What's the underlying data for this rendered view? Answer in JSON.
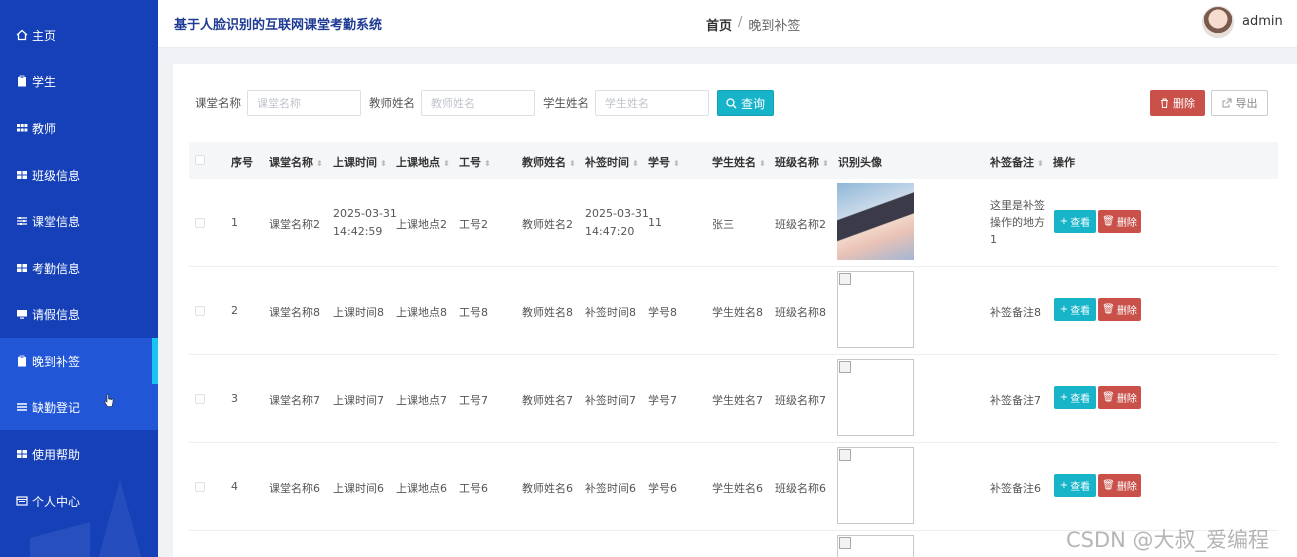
{
  "sidebar": {
    "items": [
      {
        "label": "主页",
        "icon": "home-icon"
      },
      {
        "label": "学生",
        "icon": "clipboard-icon"
      },
      {
        "label": "教师",
        "icon": "grid-icon"
      },
      {
        "label": "班级信息",
        "icon": "grid-icon"
      },
      {
        "label": "课堂信息",
        "icon": "sliders-icon"
      },
      {
        "label": "考勤信息",
        "icon": "grid-icon"
      },
      {
        "label": "请假信息",
        "icon": "monitor-icon"
      },
      {
        "label": "晚到补签",
        "icon": "clipboard-icon",
        "active": true
      },
      {
        "label": "缺勤登记",
        "icon": "list-icon"
      },
      {
        "label": "使用帮助",
        "icon": "grid-icon"
      },
      {
        "label": "个人中心",
        "icon": "id-card-icon"
      }
    ]
  },
  "header": {
    "title": "基于人脸识别的互联网课堂考勤系统",
    "breadcrumb_home": "首页",
    "breadcrumb_sep": "/",
    "breadcrumb_current": "晚到补签",
    "username": "admin"
  },
  "search": {
    "course_label": "课堂名称",
    "course_placeholder": "课堂名称",
    "teacher_label": "教师姓名",
    "teacher_placeholder": "教师姓名",
    "student_label": "学生姓名",
    "student_placeholder": "学生姓名",
    "query_label": "查询",
    "delete_label": "删除",
    "export_label": "导出"
  },
  "table": {
    "headers": {
      "index": "序号",
      "course": "课堂名称",
      "class_time": "上课时间",
      "place": "上课地点",
      "job_no": "工号",
      "teacher": "教师姓名",
      "sign_time": "补签时间",
      "student_no": "学号",
      "student": "学生姓名",
      "class_name": "班级名称",
      "photo": "识别头像",
      "remark": "补签备注",
      "action": "操作"
    },
    "view_label": "查看",
    "delete_label": "删除",
    "rows": [
      {
        "index": "1",
        "course": "课堂名称2",
        "class_time_date": "2025-03-31",
        "class_time_clock": "14:42:59",
        "place": "上课地点2",
        "job_no": "工号2",
        "teacher": "教师姓名2",
        "sign_time_date": "2025-03-31",
        "sign_time_clock": "14:47:20",
        "student_no": "11",
        "student": "张三",
        "class_name": "班级名称2",
        "remark_l1": "这里是补签",
        "remark_l2": "操作的地方",
        "remark_l3": "1"
      },
      {
        "index": "2",
        "course": "课堂名称8",
        "class_time": "上课时间8",
        "place": "上课地点8",
        "job_no": "工号8",
        "teacher": "教师姓名8",
        "sign_time": "补签时间8",
        "student_no": "学号8",
        "student": "学生姓名8",
        "class_name": "班级名称8",
        "remark": "补签备注8"
      },
      {
        "index": "3",
        "course": "课堂名称7",
        "class_time": "上课时间7",
        "place": "上课地点7",
        "job_no": "工号7",
        "teacher": "教师姓名7",
        "sign_time": "补签时间7",
        "student_no": "学号7",
        "student": "学生姓名7",
        "class_name": "班级名称7",
        "remark": "补签备注7"
      },
      {
        "index": "4",
        "course": "课堂名称6",
        "class_time": "上课时间6",
        "place": "上课地点6",
        "job_no": "工号6",
        "teacher": "教师姓名6",
        "sign_time": "补签时间6",
        "student_no": "学号6",
        "student": "学生姓名6",
        "class_name": "班级名称6",
        "remark": "补签备注6"
      }
    ]
  },
  "watermark": "CSDN @大叔_爱编程",
  "colors": {
    "sidebar_bg": "#1540b8",
    "sidebar_active": "#2157d6",
    "accent_cyan": "#17b3c9",
    "danger": "#c9514a",
    "title_blue": "#1f3a93"
  }
}
